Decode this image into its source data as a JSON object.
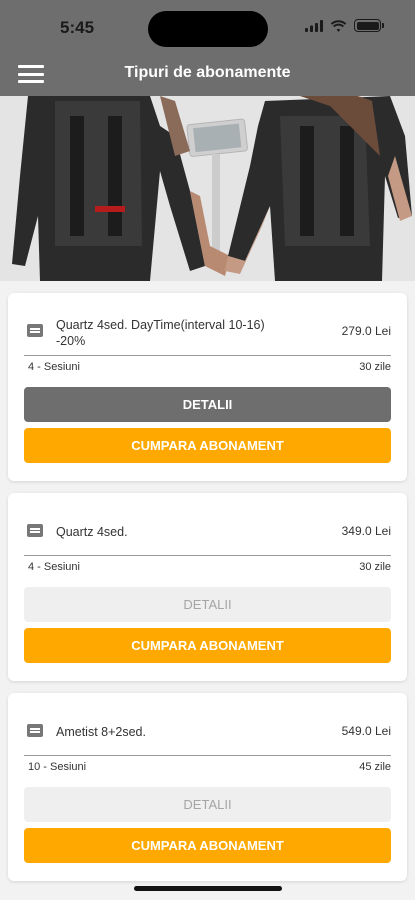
{
  "status_bar": {
    "time": "5:45",
    "icons": [
      "signal-icon",
      "wifi-icon",
      "battery-icon"
    ]
  },
  "header": {
    "title": "Tipuri de abonamente",
    "menu_icon": "hamburger-menu-icon",
    "background": "#6e6e6e"
  },
  "hero": {
    "description_icon": "fitness-banner-image"
  },
  "subscriptions": [
    {
      "name": "Quartz 4sed. DayTime(interval 10-16) -20%",
      "price": "279.0 Lei",
      "sessions": "4 - Sesiuni",
      "days": "30 zile",
      "details_label": "DETALII",
      "details_active": true,
      "buy_label": "CUMPARA ABONAMENT"
    },
    {
      "name": "Quartz 4sed.",
      "price": "349.0 Lei",
      "sessions": "4 - Sesiuni",
      "days": "30 zile",
      "details_label": "DETALII",
      "details_active": false,
      "buy_label": "CUMPARA ABONAMENT"
    },
    {
      "name": "Ametist 8+2sed.",
      "price": "549.0 Lei",
      "sessions": "10 - Sesiuni",
      "days": "45 zile",
      "details_label": "DETALII",
      "details_active": false,
      "buy_label": "CUMPARA ABONAMENT"
    }
  ],
  "colors": {
    "accent": "#ffa800",
    "primary_button": "#6e6e6e",
    "disabled_button": "#efefef"
  }
}
